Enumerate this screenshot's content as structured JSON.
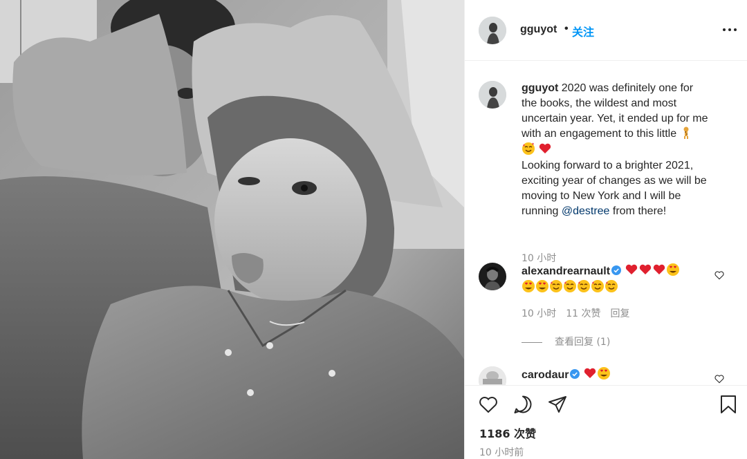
{
  "post": {
    "author": "gguyot",
    "follow_label": "关注",
    "separator": "•",
    "caption_lines": [
      "2020 was definitely one for",
      "the books, the wildest and most",
      "uncertain year. Yet, it ended up for me",
      "with an engagement to this little"
    ],
    "caption_part2_lines": [
      "Looking forward to a brighter 2021,",
      "exciting year of changes as we will be",
      "moving to New York and I will be"
    ],
    "caption_running": "running",
    "caption_mention": "@destree",
    "caption_tail": "from there!",
    "caption_time": "10 小时",
    "likes": "1186 次赞",
    "time": "10 小时前"
  },
  "comments": [
    {
      "user": "alexandrearnault",
      "verified": true,
      "time": "10 小时",
      "likes": "11 次赞",
      "reply_label": "回复",
      "view_replies": "查看回复 (1)"
    },
    {
      "user": "carodaur",
      "verified": true
    }
  ],
  "icons": {
    "like": "heart-outline-icon",
    "comment": "speech-bubble-icon",
    "share": "paper-plane-icon",
    "save": "bookmark-icon",
    "more": "more-dots-icon",
    "verified": "verified-badge-icon"
  },
  "colors": {
    "accent": "#0095f6",
    "mention": "#00376b",
    "heart_red": "#ed4956",
    "muted": "#8e8e8e"
  }
}
